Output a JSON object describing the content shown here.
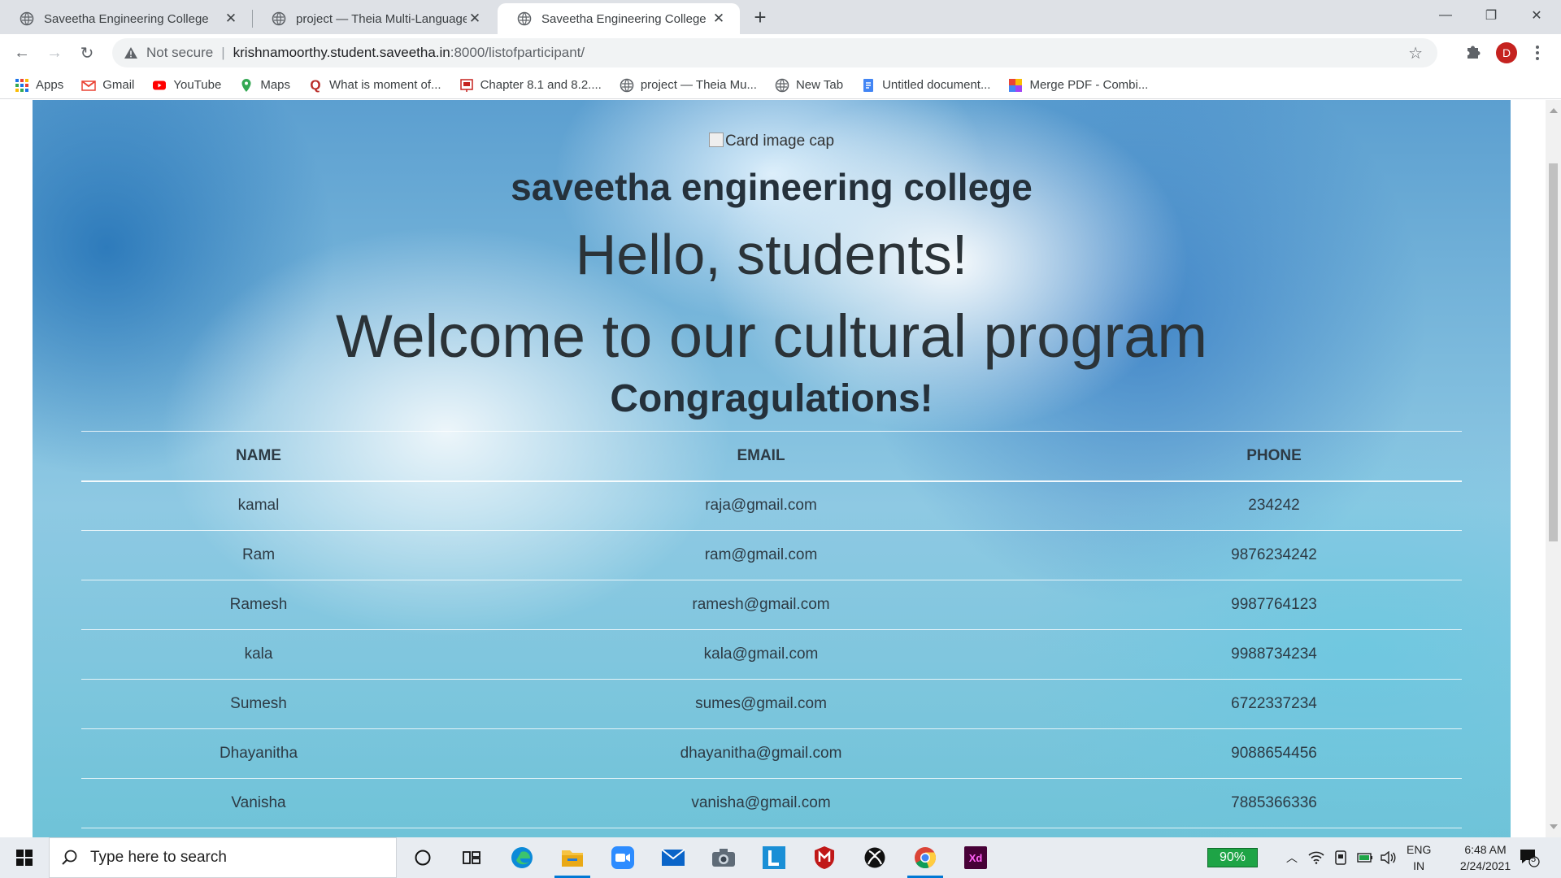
{
  "browser": {
    "tabs": [
      {
        "title": "Saveetha Engineering College",
        "active": false
      },
      {
        "title": "project — Theia Multi-Language",
        "active": false
      },
      {
        "title": "Saveetha Engineering College",
        "active": true
      }
    ],
    "address": {
      "security_label": "Not secure",
      "host": "krishnamoorthy.student.saveetha.in",
      "path": ":8000/listofparticipant/"
    },
    "profile_initial": "D",
    "bookmarks": [
      {
        "label": "Apps",
        "icon": "apps-grid-icon"
      },
      {
        "label": "Gmail",
        "icon": "gmail-icon"
      },
      {
        "label": "YouTube",
        "icon": "youtube-icon"
      },
      {
        "label": "Maps",
        "icon": "maps-pin-icon"
      },
      {
        "label": "What is moment of...",
        "icon": "quora-icon"
      },
      {
        "label": "Chapter 8.1 and 8.2....",
        "icon": "slides-icon"
      },
      {
        "label": "project — Theia Mu...",
        "icon": "globe-icon"
      },
      {
        "label": "New Tab",
        "icon": "globe-icon"
      },
      {
        "label": "Untitled document...",
        "icon": "docs-icon"
      },
      {
        "label": "Merge PDF - Combi...",
        "icon": "pdf-merge-icon"
      }
    ]
  },
  "page": {
    "image_alt": "Card image cap",
    "college": "saveetha engineering college",
    "greeting": "Hello, students!",
    "welcome": "Welcome to our cultural program",
    "congrats": "Congragulations!",
    "table": {
      "headers": [
        "NAME",
        "EMAIL",
        "PHONE"
      ],
      "rows": [
        [
          "kamal",
          "raja@gmail.com",
          "234242"
        ],
        [
          "Ram",
          "ram@gmail.com",
          "9876234242"
        ],
        [
          "Ramesh",
          "ramesh@gmail.com",
          "9987764123"
        ],
        [
          "kala",
          "kala@gmail.com",
          "9988734234"
        ],
        [
          "Sumesh",
          "sumes@gmail.com",
          "6722337234"
        ],
        [
          "Dhayanitha",
          "dhayanitha@gmail.com",
          "9088654456"
        ],
        [
          "Vanisha",
          "vanisha@gmail.com",
          "7885366336"
        ]
      ]
    }
  },
  "taskbar": {
    "search_placeholder": "Type here to search",
    "battery": "90%",
    "lang_line1": "ENG",
    "lang_line2": "IN",
    "time": "6:48 AM",
    "date": "2/24/2021",
    "notification_count": "5"
  },
  "colors": {
    "card_blue": "#5c9fd0",
    "tab_strip": "#dee1e6",
    "avatar": "#c5221f",
    "battery": "#1ea446"
  }
}
